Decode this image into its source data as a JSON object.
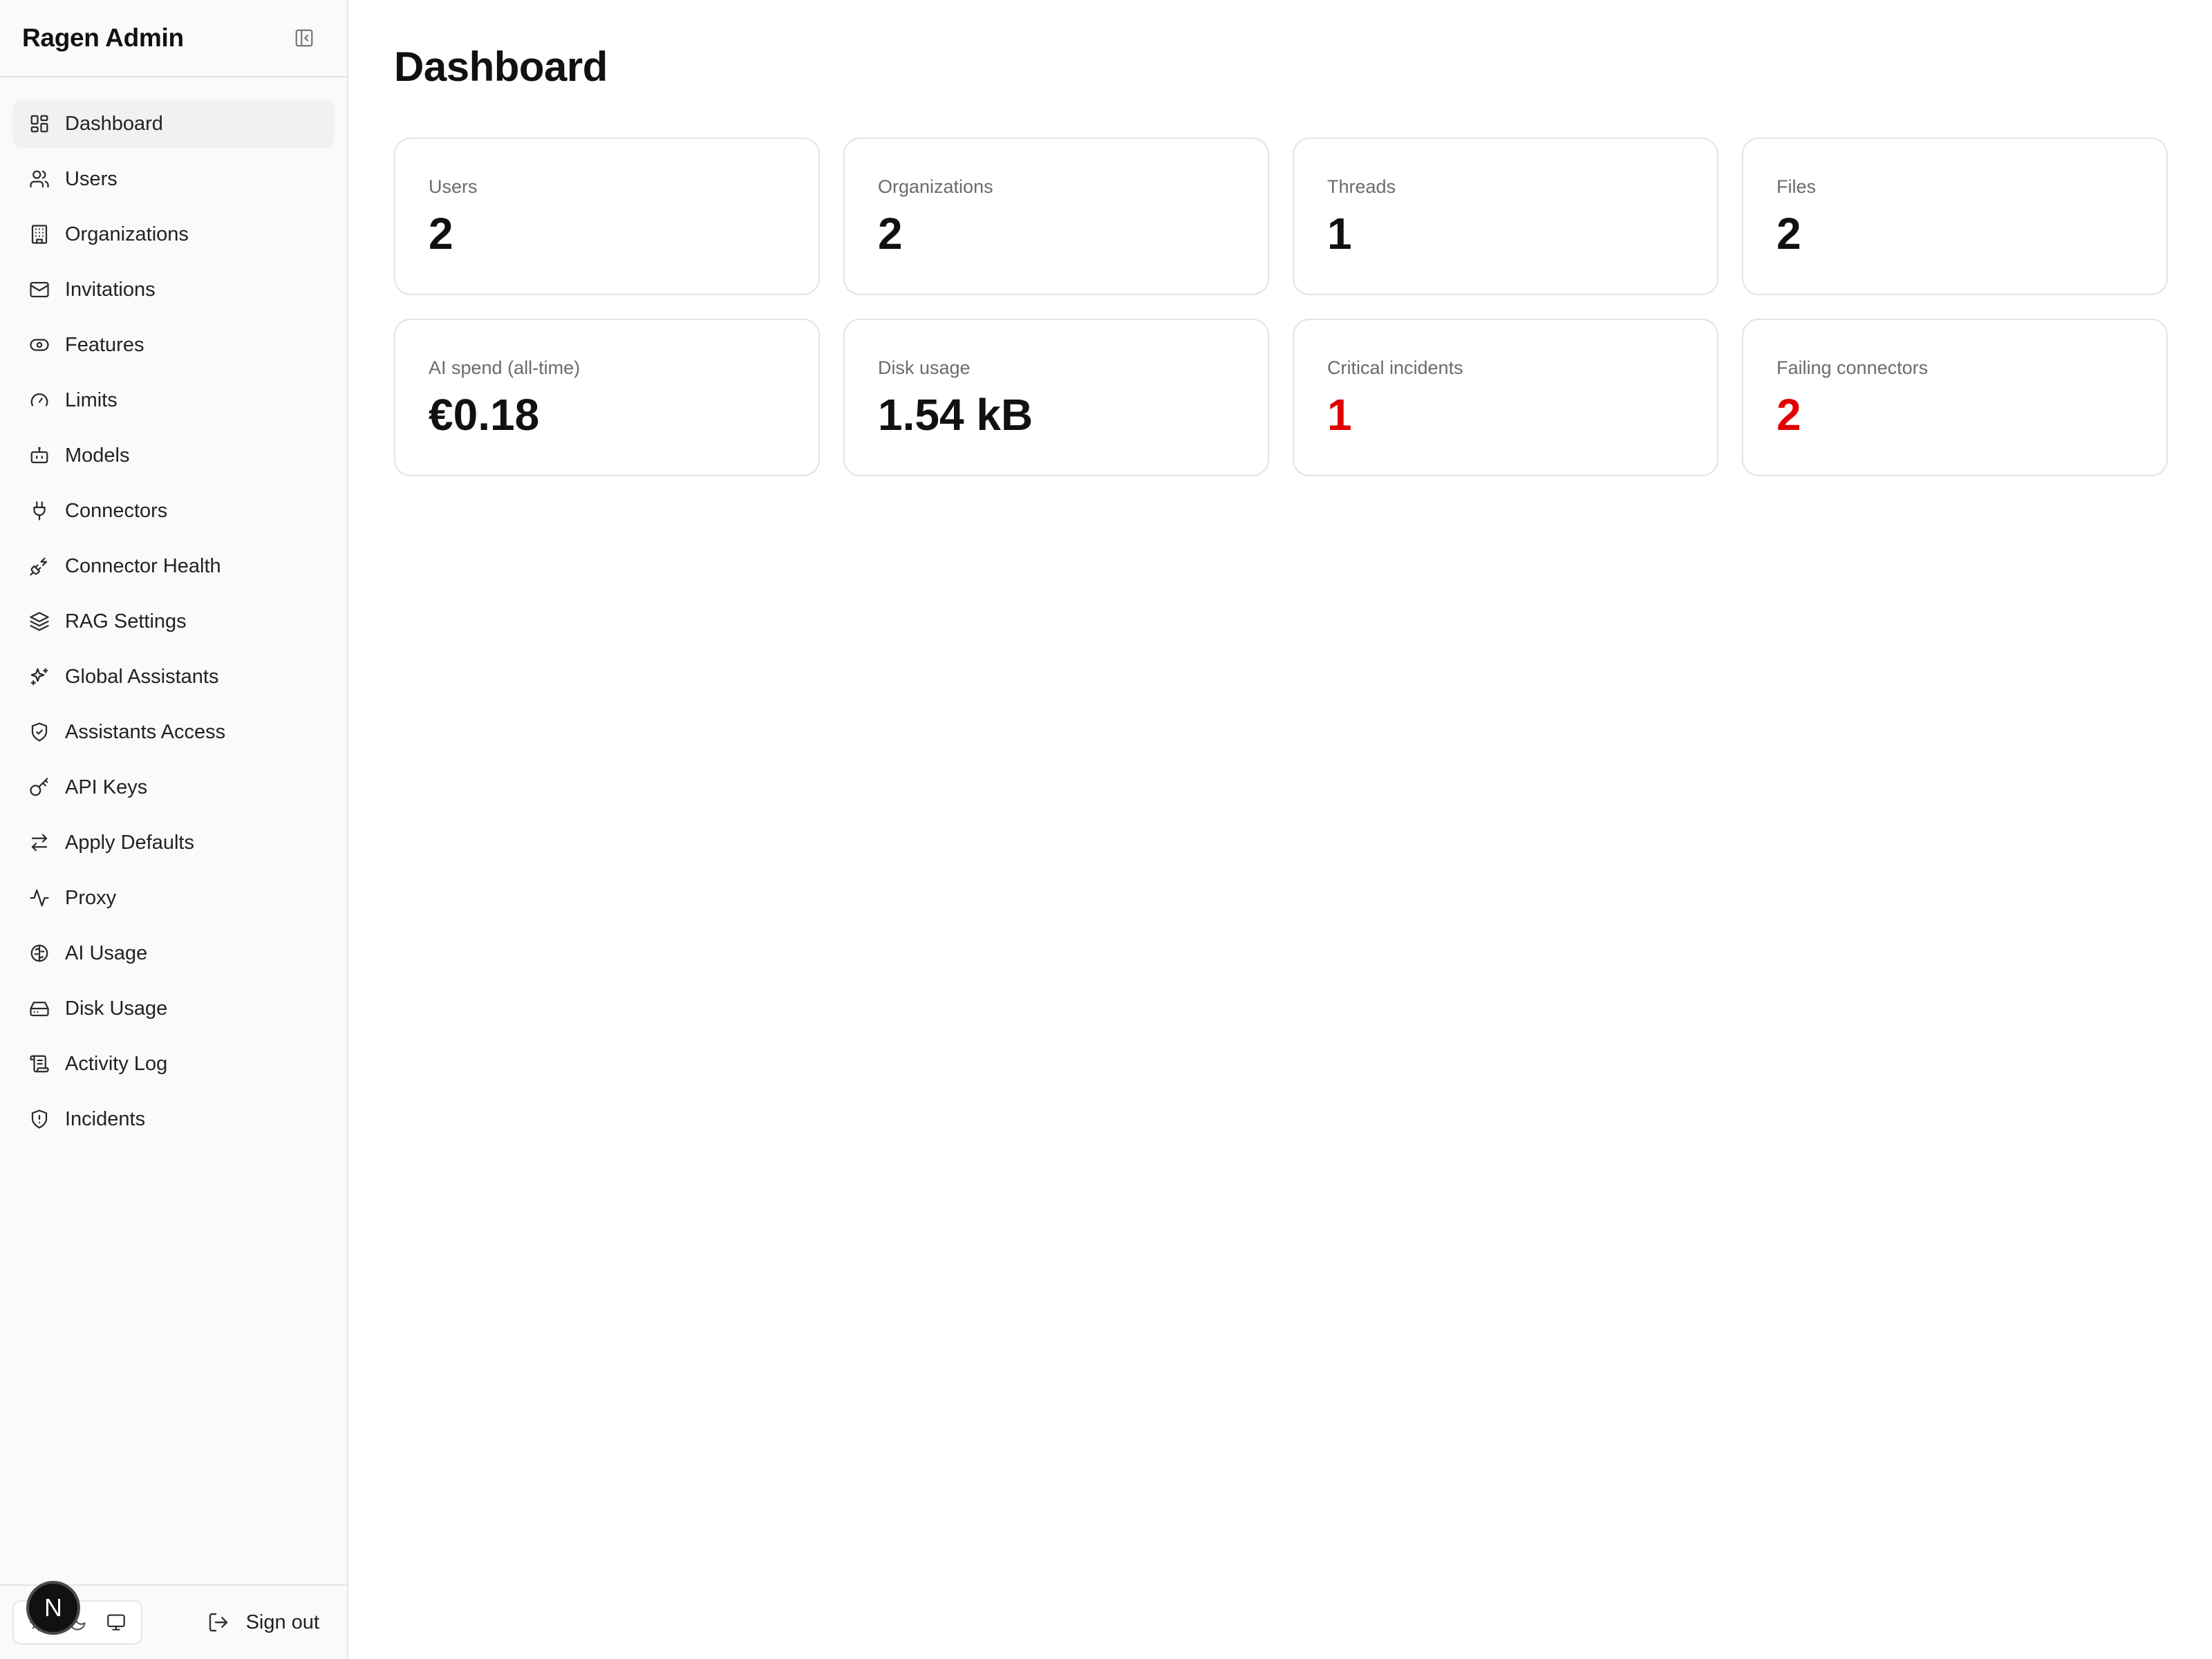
{
  "sidebar": {
    "brand": "Ragen Admin",
    "items": [
      {
        "label": "Dashboard",
        "icon": "layout-grid-icon",
        "active": true
      },
      {
        "label": "Users",
        "icon": "users-icon"
      },
      {
        "label": "Organizations",
        "icon": "building-icon"
      },
      {
        "label": "Invitations",
        "icon": "mail-icon"
      },
      {
        "label": "Features",
        "icon": "toggle-icon"
      },
      {
        "label": "Limits",
        "icon": "gauge-icon"
      },
      {
        "label": "Models",
        "icon": "bot-icon"
      },
      {
        "label": "Connectors",
        "icon": "plug-icon"
      },
      {
        "label": "Connector Health",
        "icon": "plug-zap-icon"
      },
      {
        "label": "RAG Settings",
        "icon": "layers-icon"
      },
      {
        "label": "Global Assistants",
        "icon": "sparkles-icon"
      },
      {
        "label": "Assistants Access",
        "icon": "shield-check-icon"
      },
      {
        "label": "API Keys",
        "icon": "key-icon"
      },
      {
        "label": "Apply Defaults",
        "icon": "arrows-right-left-icon"
      },
      {
        "label": "Proxy",
        "icon": "activity-icon"
      },
      {
        "label": "AI Usage",
        "icon": "brain-icon"
      },
      {
        "label": "Disk Usage",
        "icon": "hard-drive-icon"
      },
      {
        "label": "Activity Log",
        "icon": "scroll-icon"
      },
      {
        "label": "Incidents",
        "icon": "shield-alert-icon"
      }
    ],
    "footer": {
      "badge": "N",
      "sign_out": "Sign out"
    }
  },
  "main": {
    "title": "Dashboard",
    "stats": [
      {
        "label": "Users",
        "value": "2"
      },
      {
        "label": "Organizations",
        "value": "2"
      },
      {
        "label": "Threads",
        "value": "1"
      },
      {
        "label": "Files",
        "value": "2"
      },
      {
        "label": "AI spend (all-time)",
        "value": "€0.18"
      },
      {
        "label": "Disk usage",
        "value": "1.54 kB"
      },
      {
        "label": "Critical incidents",
        "value": "1",
        "alert": true
      },
      {
        "label": "Failing connectors",
        "value": "2",
        "alert": true
      }
    ]
  },
  "colors": {
    "alert": "#e00000",
    "sidebar_bg": "#fafafa",
    "active_item_bg": "#f1f1f1"
  }
}
